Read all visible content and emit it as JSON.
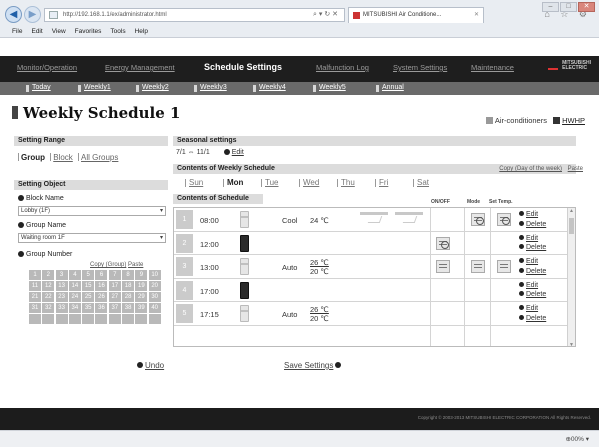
{
  "browser": {
    "address": "http://192.168.1.1/ex/administrator.html",
    "address_tools": "⌕ ▾ ↻ ✕",
    "tab_title": "MITSUBISHI Air Conditione...",
    "tab_close": "✕",
    "back_glyph": "◀",
    "forward_glyph": "▶",
    "toolbar_icons": "⌂ ☆ ⚙",
    "window_buttons": [
      "–",
      "□",
      "✕"
    ],
    "menu": [
      "File",
      "Edit",
      "View",
      "Favorites",
      "Tools",
      "Help"
    ],
    "zoom": "⊕00% ▾"
  },
  "app_nav": [
    {
      "label": "Monitor/Operation",
      "active": false
    },
    {
      "label": "Energy Management",
      "active": false
    },
    {
      "label": "Schedule Settings",
      "active": true
    },
    {
      "label": "Malfunction Log",
      "active": false
    },
    {
      "label": "System Settings",
      "active": false
    },
    {
      "label": "Maintenance",
      "active": false
    }
  ],
  "brand": {
    "line1": "MITSUBISHI",
    "line2": "ELECTRIC"
  },
  "sub_nav": [
    "Today",
    "Weekly1",
    "Weekly2",
    "Weekly3",
    "Weekly4",
    "Weekly5",
    "Annual"
  ],
  "page": {
    "title": "Weekly Schedule 1",
    "aircon_label": "Air-conditioners",
    "hwhp_label": "HWHP"
  },
  "left": {
    "setting_range_title": "Setting Range",
    "range_options": [
      "Group",
      "Block",
      "All Groups"
    ],
    "setting_object_title": "Setting Object",
    "block_name_label": "Block Name",
    "block_name_value": "Lobby (1F)",
    "group_name_label": "Group Name",
    "group_name_value": "Waiting room 1F",
    "group_number_label": "Group Number",
    "copy_group": "Copy (Group)",
    "paste": "Paste",
    "group_numbers": [
      "1",
      "2",
      "3",
      "4",
      "5",
      "6",
      "7",
      "8",
      "9",
      "10",
      "11",
      "12",
      "13",
      "14",
      "15",
      "16",
      "17",
      "18",
      "19",
      "20",
      "21",
      "22",
      "23",
      "24",
      "25",
      "26",
      "27",
      "28",
      "29",
      "30",
      "31",
      "32",
      "33",
      "34",
      "35",
      "36",
      "37",
      "38",
      "39",
      "40",
      "",
      "",
      "",
      "",
      "",
      "",
      "",
      "",
      "",
      ""
    ]
  },
  "right": {
    "seasonal_title": "Seasonal settings",
    "seasonal_range": "7/1 ⇔ 11/1",
    "seasonal_edit": "Edit",
    "contents_weekly_title": "Contents of Weekly Schedule",
    "copy_day": "Copy (Day of the week)",
    "paste": "Paste",
    "days": [
      "Sun",
      "Mon",
      "Tue",
      "Wed",
      "Thu",
      "Fri",
      "Sat"
    ],
    "selected_day": "Mon",
    "contents_schedule_title": "Contents of Schedule",
    "col_onoff": "ON/OFF",
    "col_mode": "Mode",
    "col_settemp": "Set Temp.",
    "edit": "Edit",
    "delete": "Delete",
    "rows": [
      {
        "num": "1",
        "time": "08:00",
        "state": "on",
        "mode": "Cool",
        "temp1": "24 ℃",
        "temp2": ""
      },
      {
        "num": "2",
        "time": "12:00",
        "state": "off",
        "mode": "",
        "temp1": "",
        "temp2": ""
      },
      {
        "num": "3",
        "time": "13:00",
        "state": "on",
        "mode": "Auto",
        "temp1": "26 ℃",
        "temp2": "20 ℃"
      },
      {
        "num": "4",
        "time": "17:00",
        "state": "off",
        "mode": "",
        "temp1": "",
        "temp2": ""
      },
      {
        "num": "5",
        "time": "17:15",
        "state": "on",
        "mode": "Auto",
        "temp1": "26 ℃",
        "temp2": "20 ℃"
      }
    ]
  },
  "bottom": {
    "undo": "Undo",
    "save": "Save Settings"
  },
  "footer": {
    "copyright": "Copyright © 2003-2013 MITSUBISHI ELECTRIC CORPORATION All Rights Reserved."
  }
}
